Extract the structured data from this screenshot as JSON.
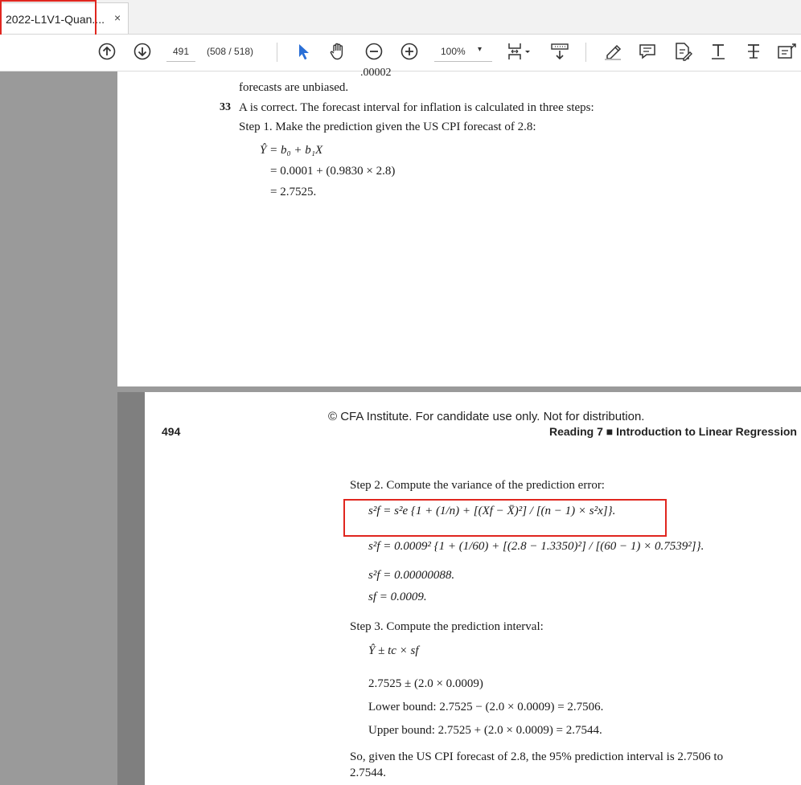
{
  "tab": {
    "title": "2022-L1V1-Quan....",
    "close": "×"
  },
  "toolbar": {
    "page_current": "491",
    "page_count": "(508 / 518)",
    "zoom": "100%",
    "zoom_caret": "▾"
  },
  "page1": {
    "cut_text": ".00002",
    "line_unbiased": "forecasts are unbiased.",
    "q_number": "33",
    "q_text": "A is correct. The forecast interval for inflation is calculated in three steps:",
    "step1": "Step 1. Make the prediction given the US CPI forecast of 2.8:",
    "eq1": "Ŷ = b₀ + b₁X",
    "eq2": "= 0.0001 + (0.9830 × 2.8)",
    "eq3": "= 2.7525."
  },
  "page2": {
    "copyright": "© CFA Institute. For candidate use only. Not for distribution.",
    "page_number": "494",
    "running_head": "Reading 7 ■ Introduction to Linear Regression",
    "step2": "Step 2. Compute the variance of the prediction error:",
    "formula_var": "s²f = s²e {1 + (1/n) + [(Xf − X̄)²] / [(n − 1) × s²x]}.",
    "formula_var_num": "s²f = 0.0009² {1 + (1/60) + [(2.8 − 1.3350)²] / [(60 − 1) × 0.7539²]}.",
    "formula_var_result": "s²f = 0.00000088.",
    "formula_sf": "sf = 0.0009.",
    "step3": "Step 3. Compute the prediction interval:",
    "formula_interval": "Ŷ ± tc × sf",
    "interval_calc": "2.7525 ± (2.0 × 0.0009)",
    "lower_bound": "Lower bound: 2.7525 − (2.0 × 0.0009) = 2.7506.",
    "upper_bound": "Upper bound: 2.7525 + (2.0 × 0.0009) = 2.7544.",
    "conclusion_line1": "So, given the US CPI forecast of 2.8, the 95% prediction interval is 2.7506 to",
    "conclusion_line2": "2.7544."
  },
  "colors": {
    "highlight_box": "#e0261f",
    "gutter": "#9a9a9a",
    "cursor_blue": "#2a6fd6"
  },
  "icons": [
    "arrow-up-circle-icon",
    "arrow-down-circle-icon",
    "select-cursor-icon",
    "hand-tool-icon",
    "zoom-out-icon",
    "zoom-in-icon",
    "page-fit-icon",
    "download-icon",
    "highlighter-icon",
    "comment-icon",
    "sign-icon",
    "text-icon",
    "strikethrough-icon",
    "edit-text-icon"
  ]
}
